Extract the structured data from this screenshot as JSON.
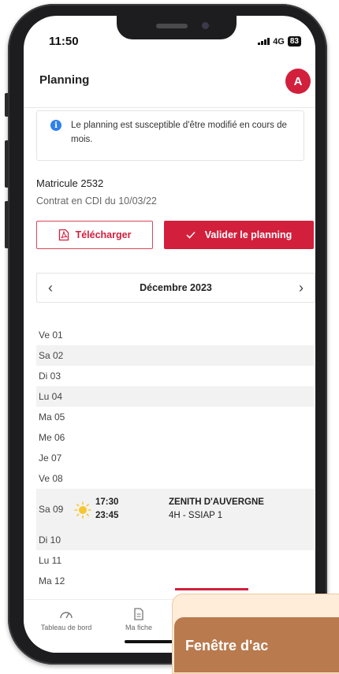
{
  "status_bar": {
    "time": "11:50",
    "network": "4G",
    "battery": "83"
  },
  "header": {
    "title": "Planning",
    "avatar_initial": "A"
  },
  "info_banner": {
    "text": "Le planning est susceptible d'être modifié en cours de mois."
  },
  "employee": {
    "matricule": "Matricule 2532",
    "contract": "Contrat en CDI du 10/03/22"
  },
  "actions": {
    "download_label": "Télécharger",
    "validate_label": "Valider le planning"
  },
  "calendar": {
    "month_label": "Décembre 2023",
    "days": [
      {
        "label": "Ve 01"
      },
      {
        "label": "Sa 02"
      },
      {
        "label": "Di 03"
      },
      {
        "label": "Lu 04"
      },
      {
        "label": "Ma 05"
      },
      {
        "label": "Me 06"
      },
      {
        "label": "Je 07"
      },
      {
        "label": "Ve 08"
      },
      {
        "label": "Sa 09",
        "event": {
          "start": "17:30",
          "end": "23:45",
          "place": "ZENITH D'AUVERGNE",
          "detail": "4H - SSIAP 1"
        }
      },
      {
        "label": "Di 10"
      },
      {
        "label": "Lu 11"
      },
      {
        "label": "Ma 12"
      }
    ]
  },
  "bottom_nav": {
    "dashboard_label": "Tableau de bord",
    "profile_label": "Ma fiche"
  },
  "overlay": {
    "text": "Fenêtre d'ac"
  },
  "colors": {
    "accent": "#d21f3c",
    "info": "#2f80ed",
    "sun": "#f7c62f",
    "overlay": "#b97a4e"
  }
}
